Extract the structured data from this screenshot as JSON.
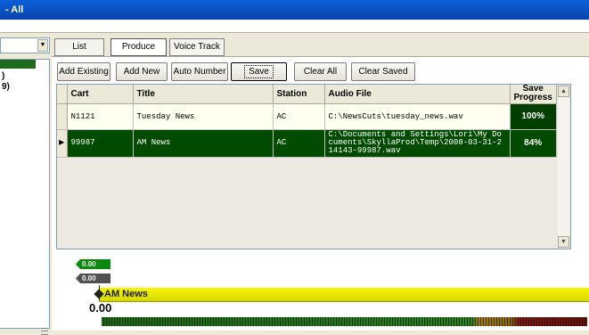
{
  "window": {
    "title": "- All"
  },
  "tabs": [
    {
      "label": "List"
    },
    {
      "label": "Produce",
      "active": true
    },
    {
      "label": "Voice Track"
    }
  ],
  "left_panel": {
    "line1": ")",
    "line2": "9)"
  },
  "toolbar": {
    "add_existing": "Add Existing",
    "add_new": "Add New",
    "auto_number": "Auto Number",
    "save": "Save",
    "clear_all": "Clear All",
    "clear_saved": "Clear Saved"
  },
  "grid": {
    "columns": [
      "Cart",
      "Title",
      "Station",
      "Audio File",
      "Save Progress"
    ],
    "rows": [
      {
        "cart": "N1121",
        "title": "Tuesday News",
        "station": "AC",
        "audio_file": "C:\\NewsCuts\\tuesday_news.wav",
        "progress": "100%"
      },
      {
        "cart": "99987",
        "title": "AM News",
        "station": "AC",
        "audio_file": "C:\\Documents and Settings\\Lori\\My Documents\\SkyllaProd\\Temp\\2008-03-31-214143-99987.wav",
        "progress": "84%",
        "selected": true
      }
    ]
  },
  "timeline": {
    "marker_green": "0.00",
    "marker_gray": "0.00",
    "clip_title": "AM News",
    "time": "0.00"
  },
  "colors": {
    "selected_row": "#004b00",
    "progress_cell": "#003f00",
    "clip_bar": "#f0f000",
    "titlebar": "#0a5fd8"
  }
}
